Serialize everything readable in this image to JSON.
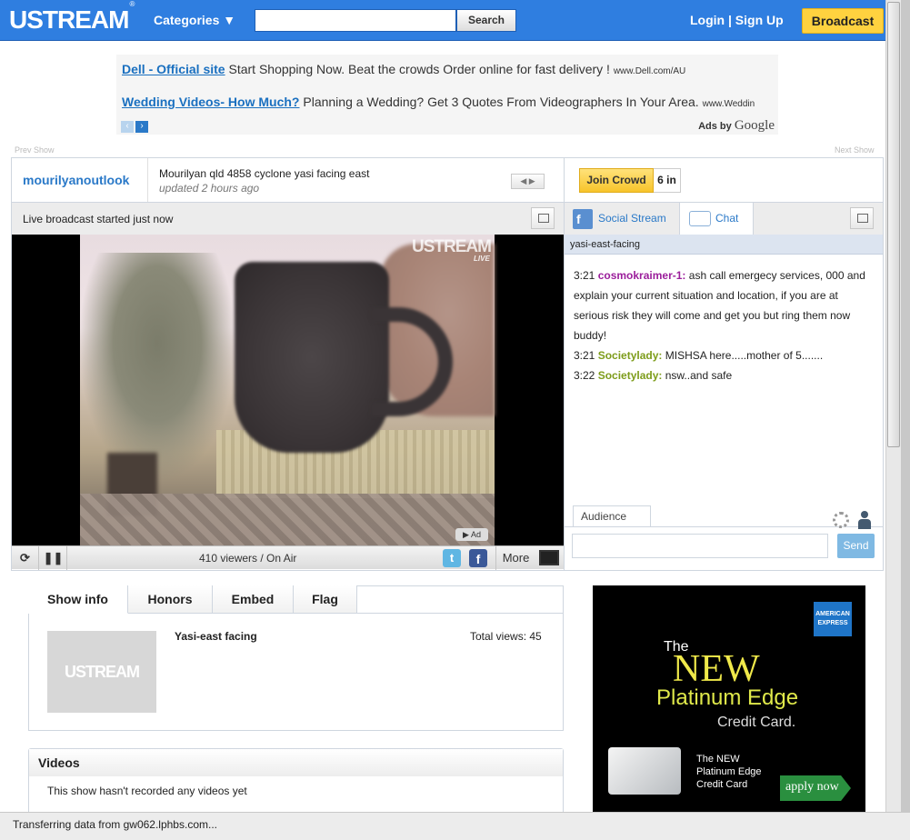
{
  "header": {
    "logo": "USTREAM",
    "logo_mark": "®",
    "categories": "Categories ▼",
    "search_button": "Search",
    "search_value": "",
    "login": "Login | Sign Up",
    "broadcast": "Broadcast",
    "bar_color": "#2f7ee0",
    "broadcast_color": "#ffd23f"
  },
  "ads": {
    "ad1_title": "Dell - Official site",
    "ad1_text": "Start Shopping Now. Beat the crowds Order online for fast delivery !",
    "ad1_url": "www.Dell.com/AU",
    "ad2_title": "Wedding Videos- How Much?",
    "ad2_text": "Planning a Wedding? Get 3 Quotes From Videographers In Your Area.",
    "ad2_url": "www.Weddin",
    "ads_by": "Ads by",
    "google": "Google"
  },
  "show_nav": {
    "prev": "Prev Show",
    "next": "Next Show"
  },
  "show": {
    "channel": "mourilyanoutlook",
    "title": "Mourilyan qld 4858 cyclone yasi facing east",
    "updated": "updated 2 hours ago",
    "live_text": "Live broadcast started just now",
    "join_crowd": "Join Crowd",
    "crowd_count": "6 in"
  },
  "player": {
    "overlay_logo": "USTREAM",
    "overlay_live": "LIVE",
    "ad_badge": "▶ Ad",
    "viewers": "410 viewers / On Air",
    "more": "More"
  },
  "social": {
    "social_stream_tab": "Social Stream",
    "chat_tab": "Chat",
    "room": "yasi-east-facing",
    "messages": [
      {
        "time": "3:21",
        "user": "cosmokraimer-1:",
        "text": "ash call emergecy services, 000 and explain your current situation and location, if you are at serious risk they will come and get you but ring them now buddy!"
      },
      {
        "time": "3:21",
        "user": "Societylady:",
        "text": "MISHSA here.....mother of 5......."
      },
      {
        "time": "3:22",
        "user": "Societylady:",
        "text": "nsw..and safe"
      }
    ],
    "audience_tab": "Audience",
    "send": "Send",
    "chat_input_value": ""
  },
  "info": {
    "tabs": [
      "Show info",
      "Honors",
      "Embed",
      "Flag"
    ],
    "thumb_text": "USTREAM",
    "show_name": "Yasi-east facing",
    "total_views": "Total views: 45"
  },
  "videos": {
    "heading": "Videos",
    "empty": "This show hasn't recorded any videos yet"
  },
  "amex_ad": {
    "logo": "AMERICAN EXPRESS",
    "the": "The",
    "new": "NEW",
    "platinum": "Platinum Edge",
    "credit_card": "Credit Card.",
    "small_text": [
      "The NEW",
      "Platinum Edge",
      "Credit Card"
    ],
    "apply": "apply now"
  },
  "statusbar": {
    "text": "Transferring data from gw062.lphbs.com..."
  }
}
